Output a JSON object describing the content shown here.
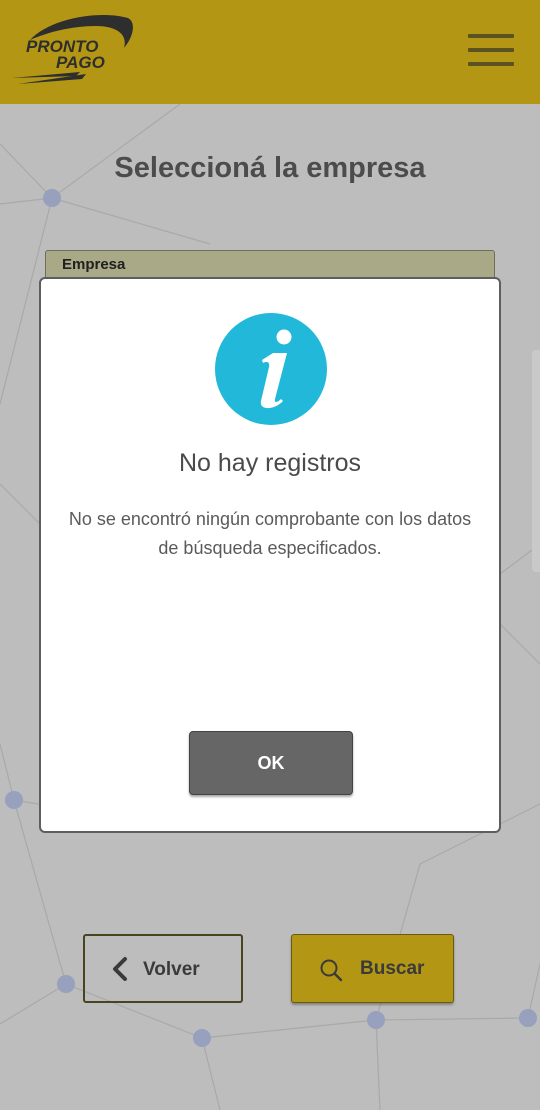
{
  "header": {
    "logo_line1": "PRONTO",
    "logo_line2": "PAGO",
    "menu_icon": "hamburger-menu-icon",
    "background_color": "#b39614"
  },
  "page": {
    "title": "Seleccioná la empresa",
    "table_header": "Empresa"
  },
  "dialog": {
    "icon": "info-icon",
    "icon_color": "#22b8d9",
    "title": "No hay registros",
    "message": "No se encontró ningún comprobante con los datos de búsqueda especificados.",
    "ok_label": "OK"
  },
  "footer": {
    "back_label": "Volver",
    "back_icon": "chevron-left-icon",
    "search_label": "Buscar",
    "search_icon": "search-icon"
  }
}
